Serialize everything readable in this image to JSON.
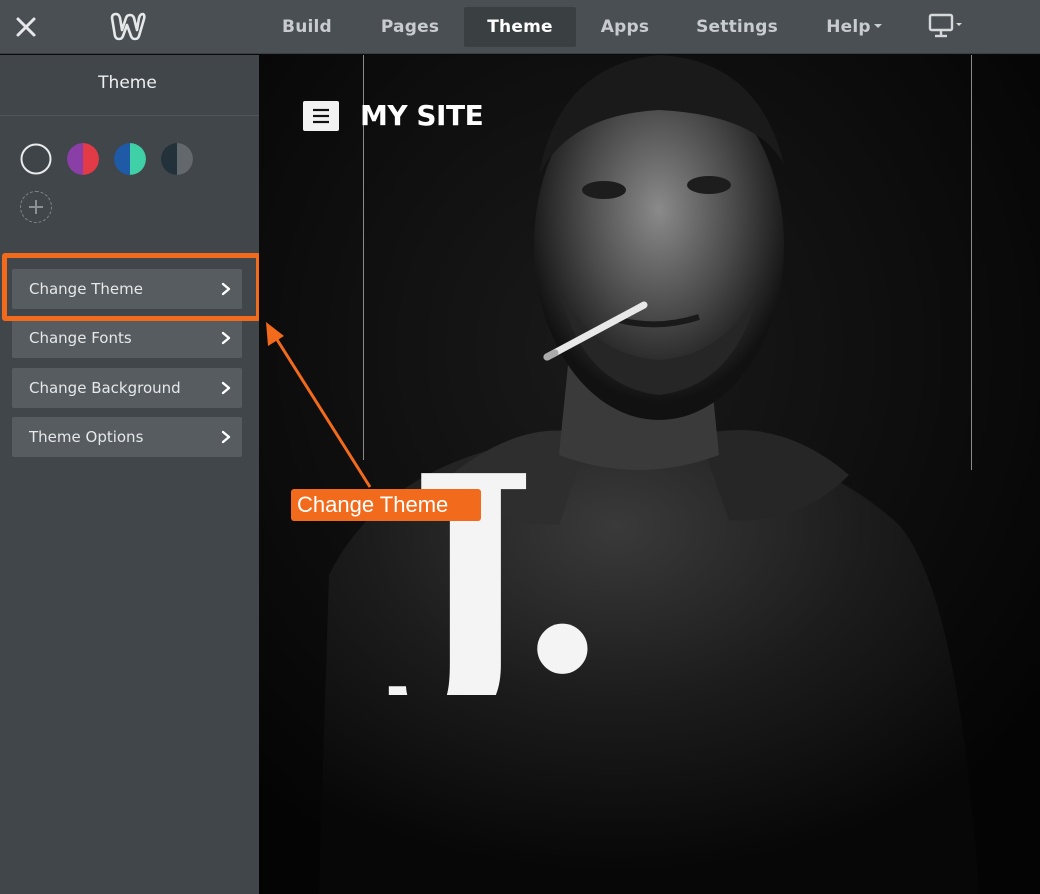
{
  "topbar": {
    "close_icon": "close-icon",
    "logo_icon": "weebly-logo-icon",
    "nav": [
      {
        "label": "Build",
        "active": false,
        "has_caret": false
      },
      {
        "label": "Pages",
        "active": false,
        "has_caret": false
      },
      {
        "label": "Theme",
        "active": true,
        "has_caret": false
      },
      {
        "label": "Apps",
        "active": false,
        "has_caret": false
      },
      {
        "label": "Settings",
        "active": false,
        "has_caret": false
      },
      {
        "label": "Help",
        "active": false,
        "has_caret": true
      }
    ],
    "device_icon": "desktop-monitor-icon"
  },
  "sidebar": {
    "title": "Theme",
    "swatches": [
      {
        "name": "swatch-dark",
        "colors": [
          "#3f4448",
          "#3f4448"
        ]
      },
      {
        "name": "swatch-purple-red",
        "colors": [
          "#8a3fa6",
          "#e23a47"
        ]
      },
      {
        "name": "swatch-blue-teal",
        "colors": [
          "#1f5aa6",
          "#3fd0a8"
        ]
      },
      {
        "name": "swatch-slate",
        "colors": [
          "#23313a",
          "#62686c"
        ]
      }
    ],
    "add_swatch_icon": "plus-icon",
    "menu": [
      {
        "label": "Change Theme"
      },
      {
        "label": "Change Fonts"
      },
      {
        "label": "Change Background"
      },
      {
        "label": "Theme Options"
      }
    ]
  },
  "canvas": {
    "site_title": "MY SITE",
    "hero_monogram": "J.",
    "hero_image": "portrait-photo"
  },
  "annotation": {
    "callout_label": "Change Theme",
    "accent_color": "#f26a1b"
  }
}
